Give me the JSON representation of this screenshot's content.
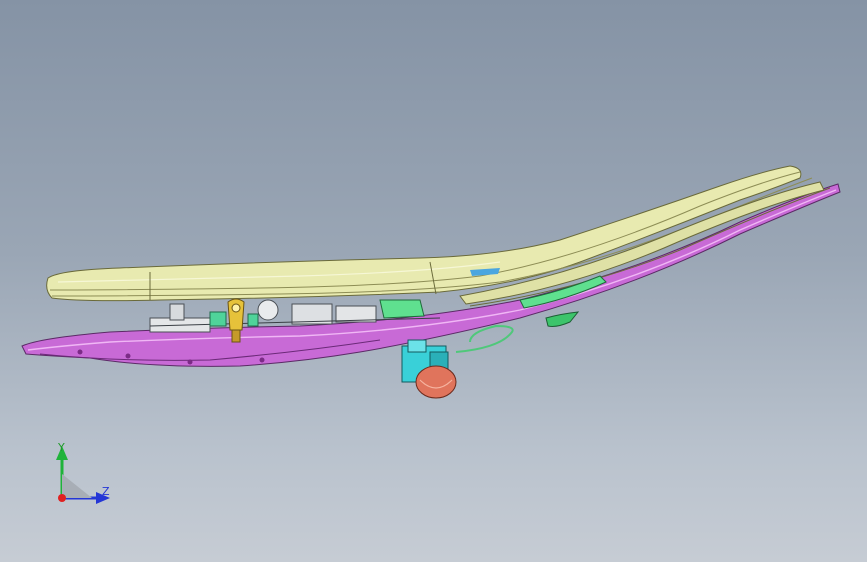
{
  "viewport": {
    "background_top": "#8593a5",
    "background_bottom": "#c6ccd4"
  },
  "model": {
    "parts": [
      {
        "name": "seat-cushion-shell",
        "color": "#e8eab0"
      },
      {
        "name": "seat-pan-frame",
        "color": "#c86ad6"
      },
      {
        "name": "center-bracket",
        "color": "#5fe08f"
      },
      {
        "name": "latch-handle",
        "color": "#e6c23a"
      },
      {
        "name": "motor-assembly",
        "color": "#39d0d8"
      },
      {
        "name": "connector-housing",
        "color": "#e0745c"
      },
      {
        "name": "wire-harness",
        "color": "#4fc87a"
      }
    ]
  },
  "triad": {
    "y_label": "Y",
    "z_label": "Z",
    "icon": "coordinate-triad-icon"
  }
}
